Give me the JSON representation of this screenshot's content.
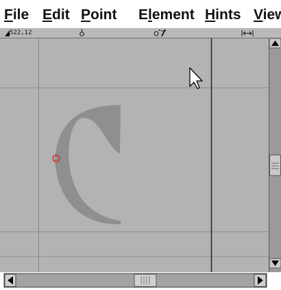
{
  "menu": {
    "file": {
      "mnemonic": "F",
      "rest": "ile"
    },
    "edit": {
      "mnemonic": "E",
      "rest": "dit"
    },
    "point": {
      "mnemonic": "P",
      "rest": "oint"
    },
    "element": {
      "pre": "E",
      "mnemonic": "l",
      "rest": "ement"
    },
    "hints": {
      "mnemonic": "H",
      "rest": "ints"
    },
    "view": {
      "mnemonic": "V",
      "rest": "iew"
    }
  },
  "infobar": {
    "coords": "522,12"
  },
  "canvas": {
    "background": "#b3b3b3",
    "glyph_color": "#8f8f8f",
    "selected_point_color": "#e02020"
  },
  "icons": {
    "cursor_position": "pointer-arrow-icon",
    "selected_point": "red-circle-point-icon"
  }
}
